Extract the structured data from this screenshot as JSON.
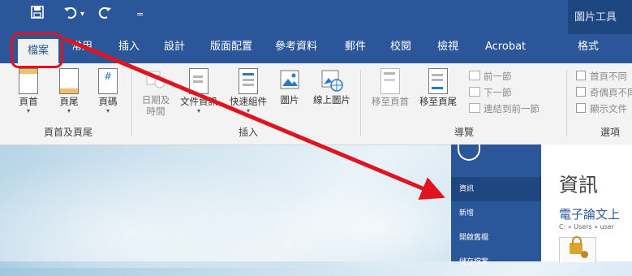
{
  "ribbon": {
    "quick_access": {
      "save_icon": "save-icon",
      "undo_icon": "undo-icon",
      "undo_dropdown": "▾",
      "redo_icon": "redo-icon",
      "customize": "="
    },
    "contextual_group_title": "圖片工具",
    "tabs": [
      {
        "label": "檔案",
        "active": true
      },
      {
        "label": "常用"
      },
      {
        "label": "插入"
      },
      {
        "label": "設計"
      },
      {
        "label": "版面配置"
      },
      {
        "label": "參考資料"
      },
      {
        "label": "郵件"
      },
      {
        "label": "校閱"
      },
      {
        "label": "檢視"
      },
      {
        "label": "Acrobat"
      },
      {
        "label": "格式"
      }
    ],
    "groups": {
      "header_footer": {
        "label": "頁首及頁尾",
        "buttons": [
          {
            "label": "頁首"
          },
          {
            "label": "頁尾"
          },
          {
            "label": "頁碼"
          }
        ]
      },
      "insert": {
        "label": "插入",
        "buttons": [
          {
            "label": "日期及",
            "label2": "時間",
            "disabled": true
          },
          {
            "label": "文件資訊",
            "disabled": false
          },
          {
            "label": "快速組件",
            "disabled": false
          },
          {
            "label": "圖片",
            "disabled": false
          },
          {
            "label": "線上圖片",
            "disabled": false
          }
        ]
      },
      "navigation": {
        "label": "導覽",
        "buttons": [
          {
            "label": "移至頁首",
            "disabled": true
          },
          {
            "label": "移至頁尾",
            "disabled": false
          }
        ],
        "small_buttons": [
          {
            "label": "前一節"
          },
          {
            "label": "下一節"
          },
          {
            "label": "連結到前一節"
          }
        ]
      },
      "options": {
        "label": "選項",
        "checkboxes": [
          {
            "label": "首頁不同"
          },
          {
            "label": "奇偶頁不同"
          },
          {
            "label": "顯示文件"
          }
        ]
      }
    }
  },
  "backstage": {
    "back_icon": "back-arrow-icon",
    "nav": [
      {
        "label": "資訊",
        "active": true
      },
      {
        "label": "新增"
      },
      {
        "label": "開啟舊檔"
      },
      {
        "label": "儲存檔案"
      }
    ],
    "title": "資訊",
    "document_name": "電子論文上",
    "path": "C: » Users » user",
    "protect_icon": "lock-icon"
  },
  "annotation": {
    "highlight_color": "#e0141e",
    "arrow_color": "#e0141e"
  },
  "colors": {
    "word_blue": "#2b579a",
    "context_blue": "#1e4680",
    "ribbon_bg": "#f3f3f3"
  }
}
